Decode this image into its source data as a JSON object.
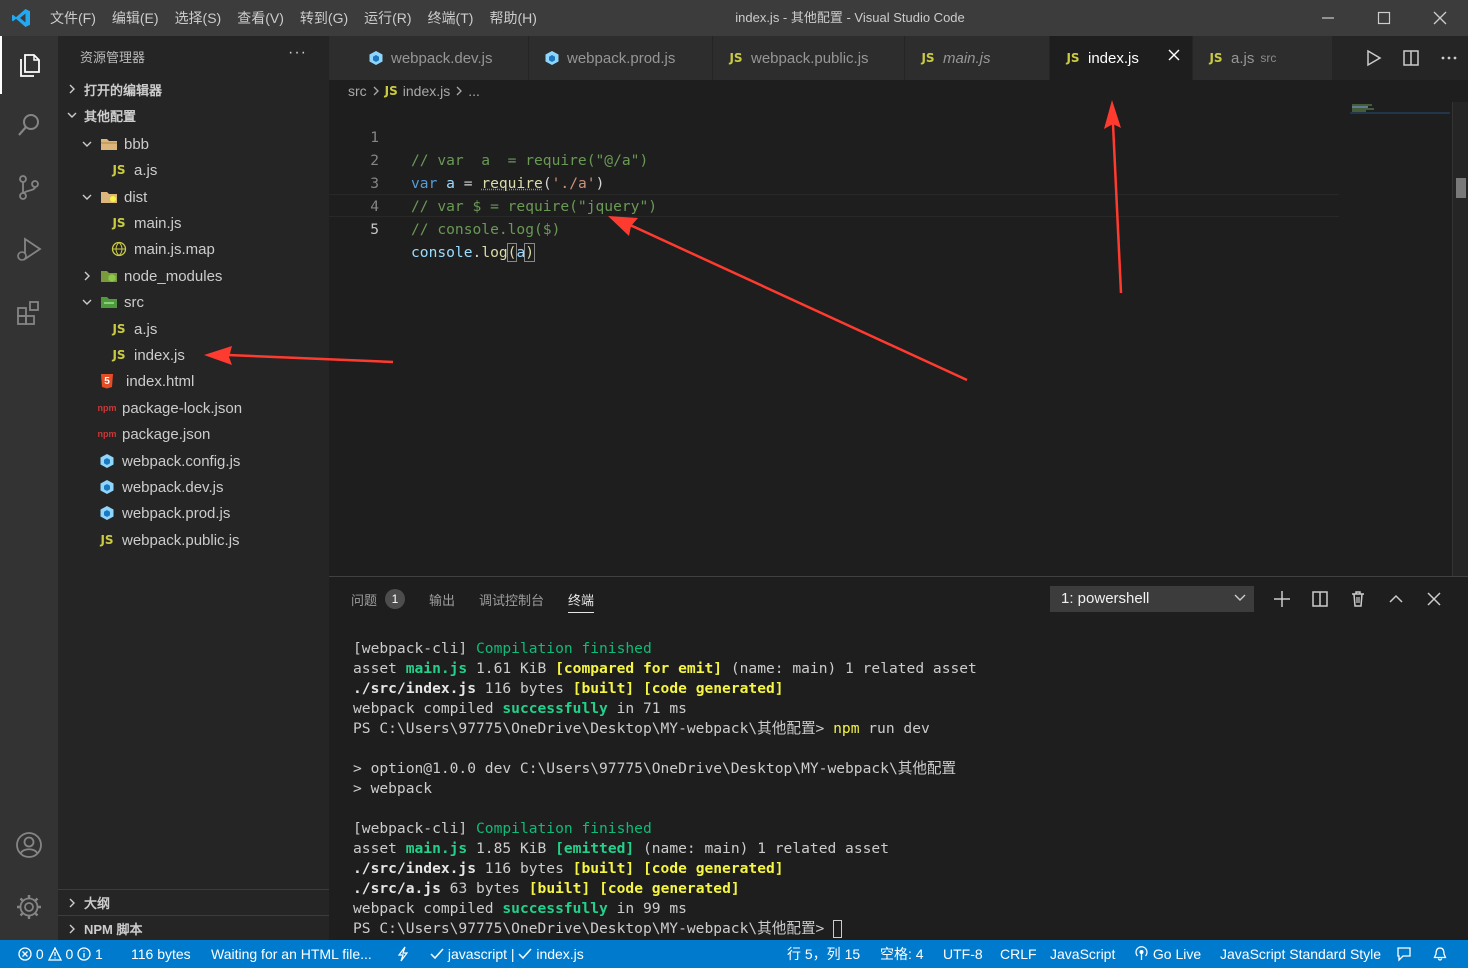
{
  "window": {
    "title": "index.js - 其他配置 - Visual Studio Code"
  },
  "menu": [
    "文件(F)",
    "编辑(E)",
    "选择(S)",
    "查看(V)",
    "转到(G)",
    "运行(R)",
    "终端(T)",
    "帮助(H)"
  ],
  "sidebar": {
    "title": "资源管理器",
    "more": "···",
    "open_editors": "打开的编辑器",
    "workspace": "其他配置",
    "tree": [
      {
        "label": "bbb",
        "kind": "folder"
      },
      {
        "label": "a.js",
        "kind": "js"
      },
      {
        "label": "dist",
        "kind": "folder"
      },
      {
        "label": "main.js",
        "kind": "js"
      },
      {
        "label": "main.js.map",
        "kind": "map"
      },
      {
        "label": "node_modules",
        "kind": "folder-closed"
      },
      {
        "label": "src",
        "kind": "folder"
      },
      {
        "label": "a.js",
        "kind": "js"
      },
      {
        "label": "index.js",
        "kind": "js"
      },
      {
        "label": "index.html",
        "kind": "html"
      },
      {
        "label": "package-lock.json",
        "kind": "npm"
      },
      {
        "label": "package.json",
        "kind": "npm"
      },
      {
        "label": "webpack.config.js",
        "kind": "webpack"
      },
      {
        "label": "webpack.dev.js",
        "kind": "webpack"
      },
      {
        "label": "webpack.prod.js",
        "kind": "webpack"
      },
      {
        "label": "webpack.public.js",
        "kind": "js"
      }
    ],
    "outline": "大纲",
    "npm_scripts": "NPM 脚本"
  },
  "tabs": [
    {
      "label": "webpack.dev.js",
      "icon": "webpack"
    },
    {
      "label": "webpack.prod.js",
      "icon": "webpack"
    },
    {
      "label": "webpack.public.js",
      "icon": "js"
    },
    {
      "label": "main.js",
      "icon": "js"
    },
    {
      "label": "index.js",
      "icon": "js"
    },
    {
      "label": "a.js",
      "icon": "js",
      "desc": "src"
    }
  ],
  "icons": {
    "js_label": "JS",
    "html_label": "5",
    "npm_label": "npm"
  },
  "breadcrumb": {
    "folder": "src",
    "file": "index.js",
    "symbol": "..."
  },
  "editor": {
    "line_numbers": [
      "1",
      "2",
      "3",
      "4",
      "5"
    ],
    "line1": "// var  a  = require(\"@/a\")",
    "line2": {
      "kw": "var",
      "name": "a",
      "eq": " = ",
      "fn": "require",
      "open": "(",
      "str": "'./a'",
      "close": ")"
    },
    "line3": "// var $ = require(\"jquery\")",
    "line4": "// console.log($)",
    "line5": {
      "obj": "console",
      "dot": ".",
      "fn": "log",
      "open": "(",
      "arg": "a",
      "close": ")"
    }
  },
  "panel": {
    "tabs": {
      "problems": "问题",
      "problems_count": "1",
      "output": "输出",
      "debug": "调试控制台",
      "terminal": "终端"
    },
    "terminal_select": "1: powershell"
  },
  "terminal": {
    "l1a": "[webpack-cli] ",
    "l1b": "Compilation finished",
    "l2a": "asset ",
    "l2b": "main.js",
    "l2c": " 1.61 KiB ",
    "l2d": "[compared for emit]",
    "l2e": " (name: main) 1 related asset",
    "l3a": "./src/index.js",
    "l3b": " 116 bytes ",
    "l3c": "[built]",
    "l3d": " ",
    "l3e": "[code generated]",
    "l4a": "webpack compiled ",
    "l4b": "successfully",
    "l4c": " in 71 ms",
    "l5a": "PS C:\\Users\\97775\\OneDrive\\Desktop\\MY-webpack\\其他配置> ",
    "l5b": "npm",
    "l5c": " run dev",
    "l7": "> option@1.0.0 dev C:\\Users\\97775\\OneDrive\\Desktop\\MY-webpack\\其他配置",
    "l8": "> webpack",
    "l10a": "[webpack-cli] ",
    "l10b": "Compilation finished",
    "l11a": "asset ",
    "l11b": "main.js",
    "l11c": " 1.85 KiB ",
    "l11d": "[emitted]",
    "l11e": " (name: main) 1 related asset",
    "l12a": "./src/index.js",
    "l12b": " 116 bytes ",
    "l12c": "[built]",
    "l12d": " ",
    "l12e": "[code generated]",
    "l13a": "./src/a.js",
    "l13b": " 63 bytes ",
    "l13c": "[built]",
    "l13d": " ",
    "l13e": "[code generated]",
    "l14a": "webpack compiled ",
    "l14b": "successfully",
    "l14c": " in 99 ms",
    "l15a": "PS C:\\Users\\97775\\OneDrive\\Desktop\\MY-webpack\\其他配置> "
  },
  "statusbar": {
    "errors": "0",
    "warnings": "0",
    "info": "1",
    "size": "116 bytes",
    "waiting": "Waiting for an HTML file...",
    "lang_check": "javascript | ",
    "file_check": "index.js",
    "position": "行 5，列 15",
    "spaces": "空格: 4",
    "encoding": "UTF-8",
    "eol": "CRLF",
    "language": "JavaScript",
    "golive": "Go Live",
    "style": "JavaScript Standard Style"
  },
  "colors": {
    "accent": "#007acc",
    "annotation_arrow": "#ff3b30",
    "js_icon": "#cbcb41",
    "webpack_icon": "#8ed6fb"
  }
}
